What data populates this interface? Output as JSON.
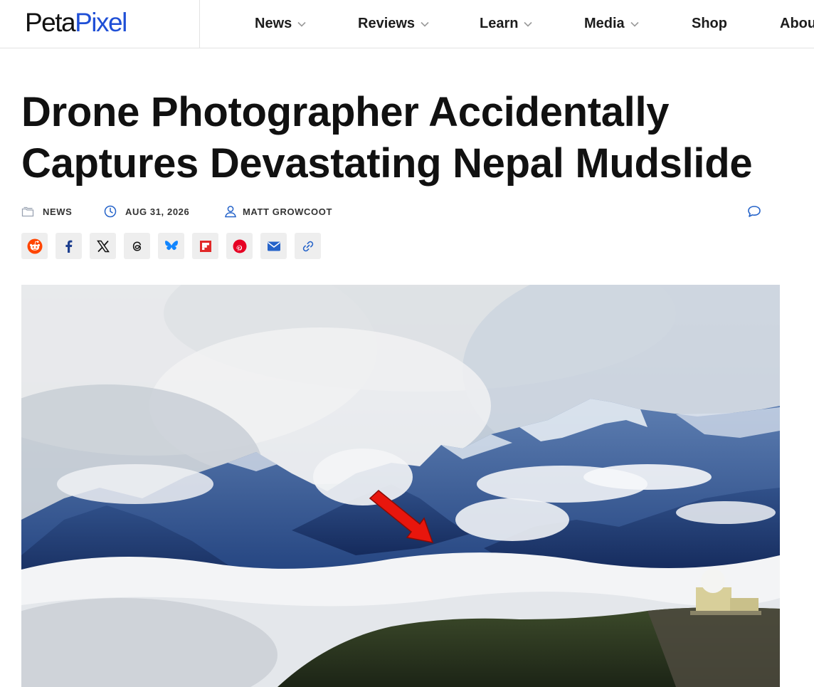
{
  "site": {
    "logo_part1": "Peta",
    "logo_part2": "Pixel"
  },
  "nav": {
    "items": [
      {
        "label": "News",
        "has_dropdown": true
      },
      {
        "label": "Reviews",
        "has_dropdown": true
      },
      {
        "label": "Learn",
        "has_dropdown": true
      },
      {
        "label": "Media",
        "has_dropdown": true
      },
      {
        "label": "Shop",
        "has_dropdown": false
      },
      {
        "label": "Abou",
        "has_dropdown": false
      }
    ]
  },
  "article": {
    "title_line1": "Drone Photographer Accidentally",
    "title_line2": "Captures Devastating Nepal Mudslide",
    "category": "NEWS",
    "date": "AUG 31, 2026",
    "author": "MATT GROWCOOT"
  },
  "share": {
    "buttons": [
      "reddit-icon",
      "facebook-icon",
      "x-icon",
      "threads-icon",
      "bluesky-icon",
      "flipboard-icon",
      "pinterest-icon",
      "email-icon",
      "link-icon"
    ]
  },
  "colors": {
    "brand_blue": "#1f4fd6",
    "icon_blue": "#2563c9",
    "reddit": "#ff4500",
    "flipboard": "#e12828",
    "pinterest": "#e60023",
    "bluesky": "#1185fe"
  }
}
